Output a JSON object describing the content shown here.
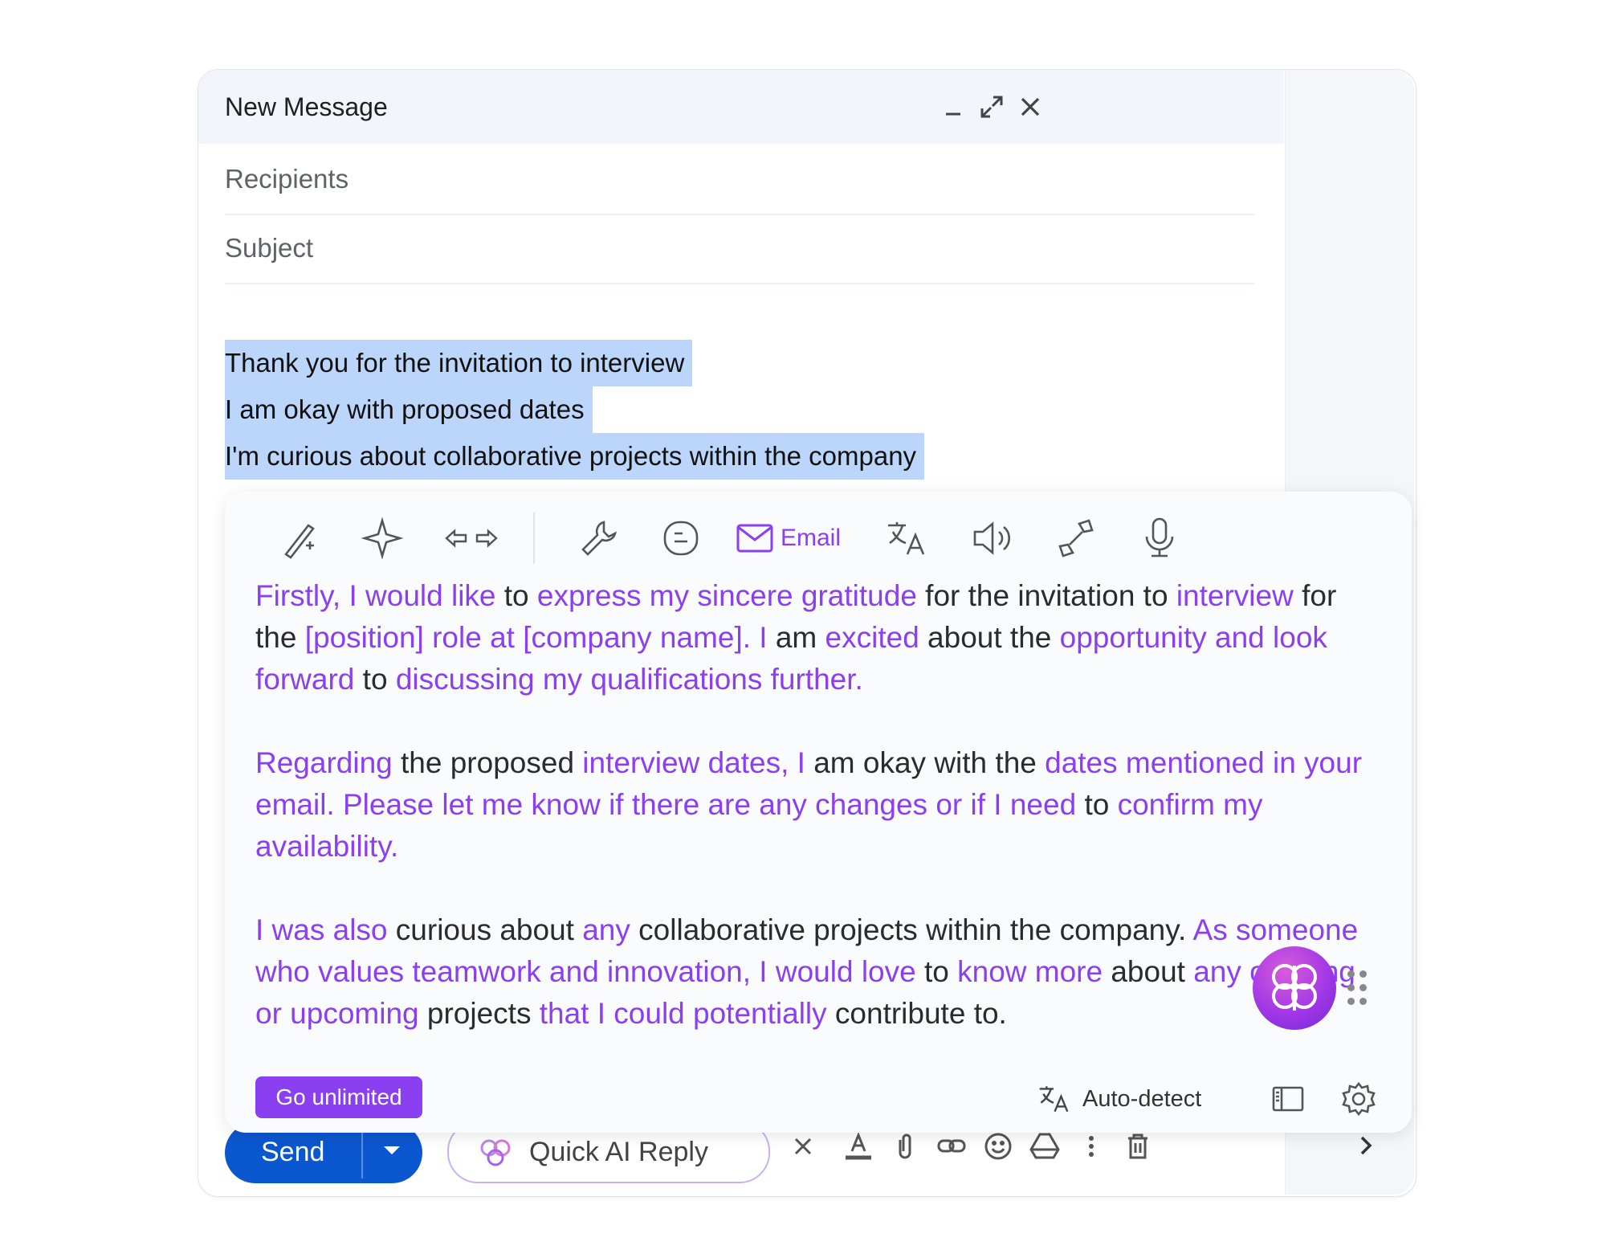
{
  "compose": {
    "title": "New Message",
    "recipients_placeholder": "Recipients",
    "subject_placeholder": "Subject",
    "selected_lines": [
      "Thank you for the invitation to interview",
      "I am okay with proposed dates",
      "I'm curious about collaborative projects within the company"
    ]
  },
  "ai_panel": {
    "toolbar": {
      "email_label": "Email",
      "icons": [
        "magic-wand-icon",
        "sparkle-icon",
        "arrows-icon",
        "wrench-icon",
        "blog-icon",
        "email-icon",
        "translate-icon",
        "speaker-icon",
        "shrink-icon",
        "microphone-icon"
      ]
    },
    "paragraphs": [
      [
        {
          "t": "Firstly, I would like",
          "h": true
        },
        {
          "t": " to ",
          "h": false
        },
        {
          "t": "express my sincere gratitude",
          "h": true
        },
        {
          "t": " for the invitation to ",
          "h": false
        },
        {
          "t": "interview",
          "h": true
        },
        {
          "t": " for the ",
          "h": false
        },
        {
          "t": "[position] role at [company name]. I",
          "h": true
        },
        {
          "t": " am ",
          "h": false
        },
        {
          "t": "excited",
          "h": true
        },
        {
          "t": " about the ",
          "h": false
        },
        {
          "t": "opportunity and look forward",
          "h": true
        },
        {
          "t": " to ",
          "h": false
        },
        {
          "t": "discussing my qualifications further.",
          "h": true
        }
      ],
      [
        {
          "t": "Regarding",
          "h": true
        },
        {
          "t": " the proposed ",
          "h": false
        },
        {
          "t": "interview dates, I",
          "h": true
        },
        {
          "t": " am okay with the ",
          "h": false
        },
        {
          "t": "dates mentioned in your email. Please let me know if there are any changes or if I need",
          "h": true
        },
        {
          "t": " to ",
          "h": false
        },
        {
          "t": "confirm my availability.",
          "h": true
        }
      ],
      [
        {
          "t": "I was also",
          "h": true
        },
        {
          "t": " curious about ",
          "h": false
        },
        {
          "t": "any",
          "h": true
        },
        {
          "t": " collaborative projects within the company. ",
          "h": false
        },
        {
          "t": "As someone who values teamwork and innovation, I would love",
          "h": true
        },
        {
          "t": " to ",
          "h": false
        },
        {
          "t": "know more",
          "h": true
        },
        {
          "t": " about ",
          "h": false
        },
        {
          "t": "any ongoing or upcoming",
          "h": true
        },
        {
          "t": " projects ",
          "h": false
        },
        {
          "t": "that I could potentially",
          "h": true
        },
        {
          "t": " contribute to.",
          "h": false
        }
      ]
    ],
    "go_unlimited": "Go unlimited",
    "language": "Auto-detect"
  },
  "bottombar": {
    "send_label": "Send",
    "quick_ai_reply": "Quick AI Reply"
  },
  "colors": {
    "accent_purple": "#8a3ff0",
    "send_blue": "#0b57d0",
    "selection_blue": "#bcd6fb"
  }
}
